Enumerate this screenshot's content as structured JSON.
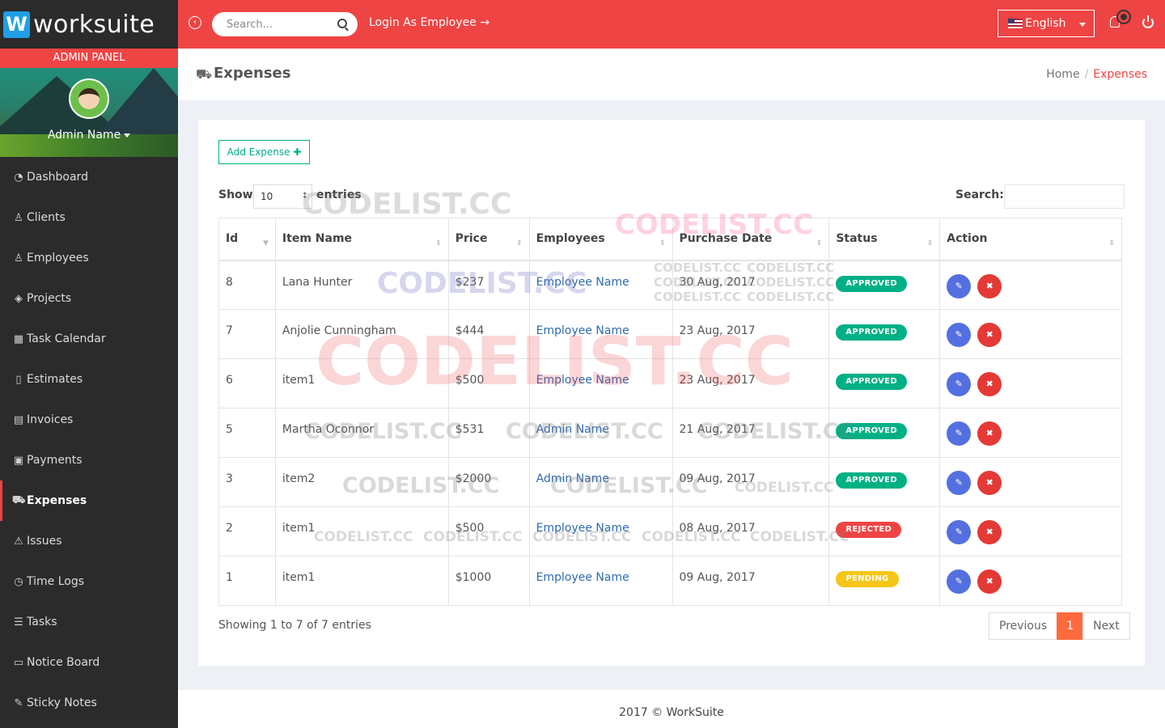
{
  "brand": {
    "logo_letter": "W",
    "name": "worksuite"
  },
  "sidebar": {
    "panel_label": "ADMIN PANEL",
    "user_name": "Admin Name",
    "items": [
      {
        "label": "Dashboard",
        "icon": "dashboard-icon",
        "glyph": "◔"
      },
      {
        "label": "Clients",
        "icon": "clients-icon",
        "glyph": "♙"
      },
      {
        "label": "Employees",
        "icon": "employees-icon",
        "glyph": "♙"
      },
      {
        "label": "Projects",
        "icon": "projects-icon",
        "glyph": "◈"
      },
      {
        "label": "Task Calendar",
        "icon": "calendar-icon",
        "glyph": "▦"
      },
      {
        "label": "Estimates",
        "icon": "estimates-icon",
        "glyph": "▯"
      },
      {
        "label": "Invoices",
        "icon": "invoices-icon",
        "glyph": "▤"
      },
      {
        "label": "Payments",
        "icon": "payments-icon",
        "glyph": "▣"
      },
      {
        "label": "Expenses",
        "icon": "cart-icon",
        "glyph": "⛟",
        "active": true
      },
      {
        "label": "Issues",
        "icon": "warning-icon",
        "glyph": "⚠"
      },
      {
        "label": "Time Logs",
        "icon": "clock-icon",
        "glyph": "◷"
      },
      {
        "label": "Tasks",
        "icon": "list-icon",
        "glyph": "☰"
      },
      {
        "label": "Notice Board",
        "icon": "notice-icon",
        "glyph": "▭"
      },
      {
        "label": "Sticky Notes",
        "icon": "note-icon",
        "glyph": "✎"
      }
    ]
  },
  "topbar": {
    "search_placeholder": "Search...",
    "login_as": "Login As Employee",
    "language": "English"
  },
  "page": {
    "title": "Expenses",
    "breadcrumb_home": "Home",
    "breadcrumb_current": "Expenses"
  },
  "toolbar": {
    "add_label": "Add Expense ✚",
    "show_label": "Show",
    "page_length": "10",
    "entries_label": "entries",
    "search_label": "Search:"
  },
  "table": {
    "columns": [
      "Id",
      "Item Name",
      "Price",
      "Employees",
      "Purchase Date",
      "Status",
      "Action"
    ],
    "rows": [
      {
        "id": "8",
        "item": "Lana Hunter",
        "price": "$237",
        "employee": "Employee Name",
        "date": "30 Aug, 2017",
        "status": "APPROVED",
        "status_type": "approved"
      },
      {
        "id": "7",
        "item": "Anjolie Cunningham",
        "price": "$444",
        "employee": "Employee Name",
        "date": "23 Aug, 2017",
        "status": "APPROVED",
        "status_type": "approved"
      },
      {
        "id": "6",
        "item": "item1",
        "price": "$500",
        "employee": "Employee Name",
        "date": "23 Aug, 2017",
        "status": "APPROVED",
        "status_type": "approved"
      },
      {
        "id": "5",
        "item": "Martha Oconnor",
        "price": "$531",
        "employee": "Admin Name",
        "date": "21 Aug, 2017",
        "status": "APPROVED",
        "status_type": "approved"
      },
      {
        "id": "3",
        "item": "item2",
        "price": "$2000",
        "employee": "Admin Name",
        "date": "09 Aug, 2017",
        "status": "APPROVED",
        "status_type": "approved"
      },
      {
        "id": "2",
        "item": "item1",
        "price": "$500",
        "employee": "Employee Name",
        "date": "08 Aug, 2017",
        "status": "REJECTED",
        "status_type": "rejected"
      },
      {
        "id": "1",
        "item": "item1",
        "price": "$1000",
        "employee": "Employee Name",
        "date": "09 Aug, 2017",
        "status": "PENDING",
        "status_type": "pending"
      }
    ]
  },
  "pagination": {
    "info": "Showing 1 to 7 of 7 entries",
    "previous": "Previous",
    "current": "1",
    "next": "Next"
  },
  "footer": {
    "text": "2017 © WorkSuite"
  },
  "watermark": "CODELIST.CC",
  "colors": {
    "accent": "#ef4444",
    "approved": "#00b085",
    "rejected": "#ef4444",
    "pending": "#f5c518",
    "edit": "#5470e0",
    "delete": "#e53935",
    "page_active": "#ff6a3d"
  }
}
